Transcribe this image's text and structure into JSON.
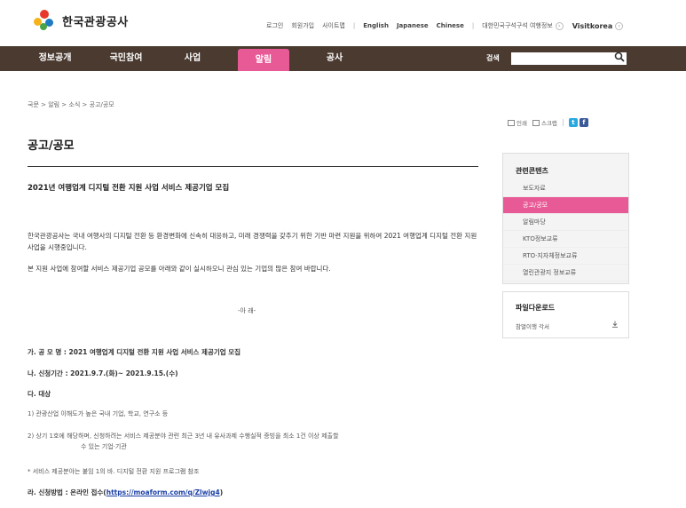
{
  "header": {
    "logo_text": "한국관광공사",
    "util_links": [
      "로그인",
      "회원가입",
      "사이트맵"
    ],
    "languages": [
      "English",
      "Japanese",
      "Chinese"
    ],
    "korea_info": "대한민국구석구석 여행정보",
    "visitkorea": "Visitkorea"
  },
  "gnb": {
    "items": [
      "정보공개",
      "국민참여",
      "사업",
      "알림",
      "공사"
    ],
    "active_index": 3,
    "search_label": "검색"
  },
  "breadcrumb": "국문 > 알림 > 소식 > 공고/공모",
  "page_title": "공고/공모",
  "post": {
    "title": "2021년 여행업계 디지털 전환 지원 사업 서비스 제공기업 모집",
    "intro": "한국관광공사는 국내 여행사의 디지털 전환 등 환경변화에 신속히 대응하고, 미래 경쟁력을 갖추기 위한 기반 마련 지원을 위하여 2021 여행업계 디지털 전환 지원 사업을 시행중입니다.",
    "intro2": "본 지원 사업에 참여할 서비스 제공기업 공모를 아래와 같이 실시하오니 관심 있는 기업의 많은 참여 바랍니다.",
    "center_note": "-아 래-",
    "line_ga": "가. 공 모 명 : 2021 여행업계 디지털 전환 지원 사업 서비스 제공기업 모집",
    "line_na": "나. 신청기간 : 2021.9.7.(화)~ 2021.9.15.(수)",
    "line_da": "다. 대상",
    "item1": "1) 관광산업 이해도가 높은 국내 기업, 학교, 연구소 등",
    "item2_a": "2) 상기 1호에 해당하며, 신청하려는 서비스 제공분야 관련 최근 3년 내 유사과제 수행실적 증빙을 최소 1건 이상 제출할",
    "item2_b": "수 있는 기업·기관",
    "note": "* 서비스 제공분야는 붙임 1의 바. 디지털 전환 지원 프로그램 참조",
    "line_ra_prefix": "라. 신청방법 : 온라인 접수(",
    "line_ra_link": "https://moaform.com/q/Zlwjg4",
    "line_ra_suffix": ")"
  },
  "tools": {
    "print": "인쇄",
    "scrap": "스크랩"
  },
  "sidebar": {
    "head": "관련콘텐츠",
    "items": [
      "보도자료",
      "공고/공모",
      "알림마당",
      "KTO정보교류",
      "RTO·지자체정보교류",
      "열린관광지 정보교류"
    ],
    "active_index": 1
  },
  "files": {
    "head": "파일다운로드",
    "item": "참멀이행 각서"
  },
  "colors": {
    "gnb_bg": "#4a3a30",
    "accent_pink": "#e85a96",
    "link_blue": "#1a3fa6"
  }
}
